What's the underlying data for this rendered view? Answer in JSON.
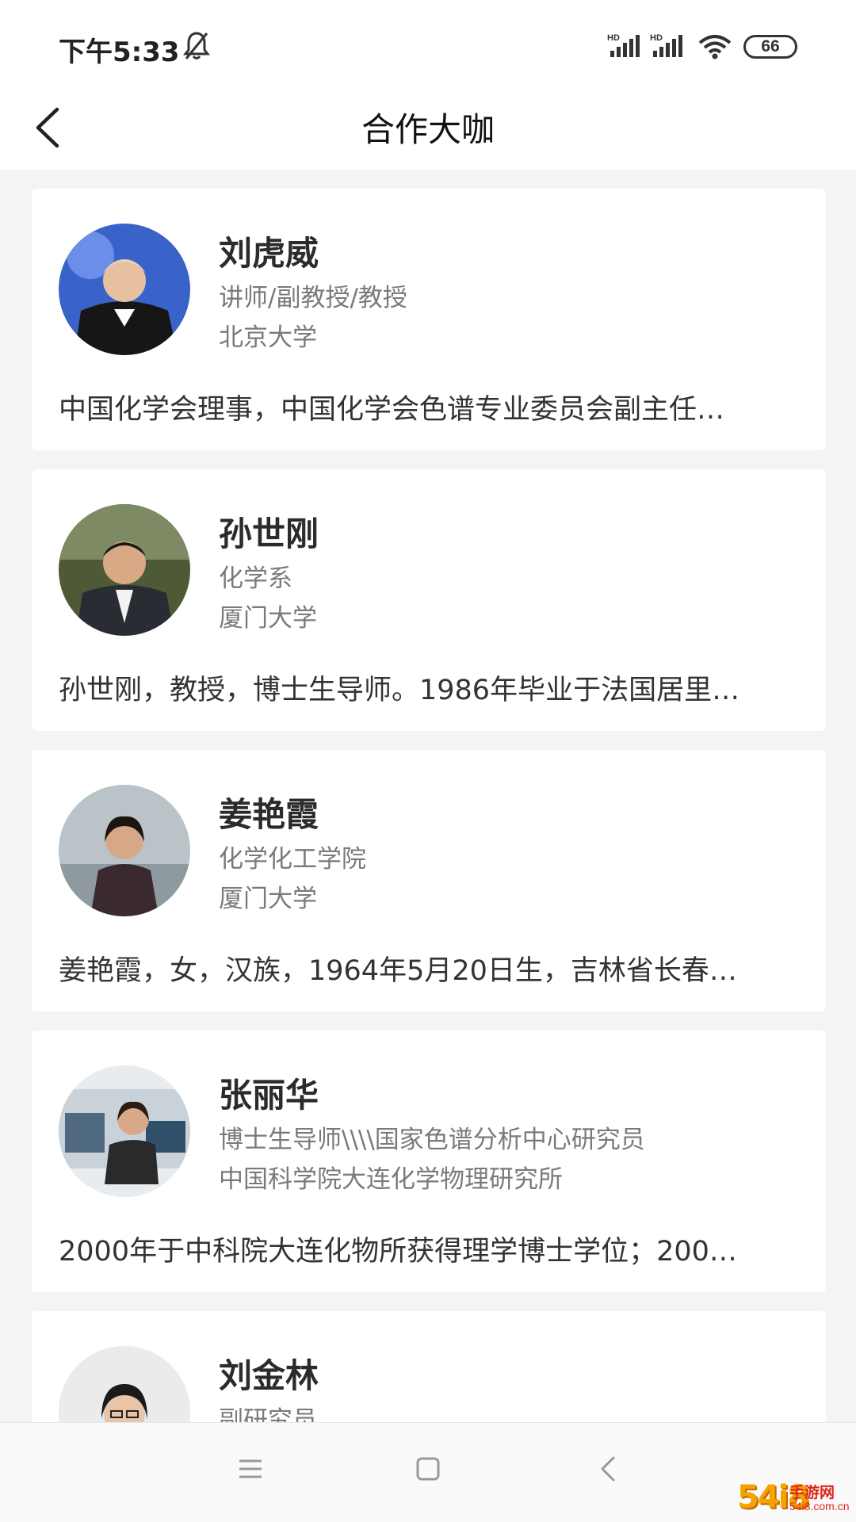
{
  "status_bar": {
    "time": "下午5:33",
    "battery": "66",
    "icons": [
      "bell-muted-icon",
      "signal-hd-icon",
      "signal-hd-icon",
      "wifi-icon",
      "battery-icon"
    ]
  },
  "header": {
    "title": "合作大咖",
    "back_icon": "chevron-left-icon"
  },
  "experts": [
    {
      "name": "刘虎威",
      "title": "讲师/副教授/教授",
      "org": "北京大学",
      "desc": "中国化学会理事，中国化学会色谱专业委员会副主任…"
    },
    {
      "name": "孙世刚",
      "title": "化学系",
      "org": "厦门大学",
      "desc": "孙世刚，教授，博士生导师。1986年毕业于法国居里…"
    },
    {
      "name": "姜艳霞",
      "title": "化学化工学院",
      "org": "厦门大学",
      "desc": "姜艳霞，女，汉族，1964年5月20日生，吉林省长春…"
    },
    {
      "name": "张丽华",
      "title": "博士生导师\\\\\\\\国家色谱分析中心研究员",
      "org": "中国科学院大连化学物理研究所",
      "desc": "2000年于中科院大连化物所获得理学博士学位；200…"
    },
    {
      "name": "刘金林",
      "title": "副研究员",
      "org": "",
      "desc": ""
    }
  ],
  "nav_bar": {
    "icons": [
      "menu-icon",
      "home-square-icon",
      "back-triangle-icon"
    ]
  },
  "watermark": {
    "number": "54i8",
    "text": "手游网",
    "domain": "54i8.com.cn"
  }
}
